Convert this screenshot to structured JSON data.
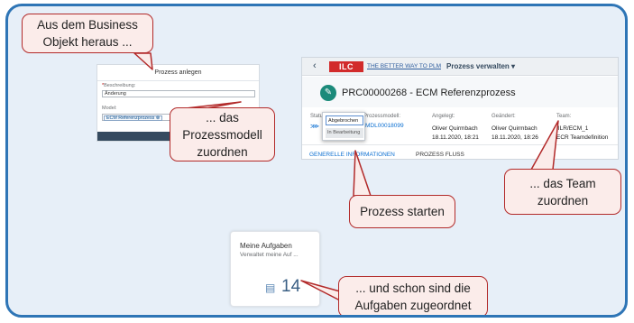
{
  "callouts": {
    "business_object": "Aus dem Business Objekt heraus ...",
    "process_model": "... das Prozessmodell zuordnen",
    "start_process": "Prozess starten",
    "team": "... das Team zuordnen",
    "tasks": "... und schon sind die Aufgaben zugeordnet"
  },
  "dialog": {
    "title": "Prozess anlegen",
    "description_label": "Beschreibung:",
    "description_value": "Änderung",
    "model_label": "Model:",
    "model_token": "ECM Referenzprozess ⊗",
    "value_help_icon": "value-help-icon"
  },
  "app": {
    "back_icon": "back-icon",
    "logo_text": "ILC",
    "tagline": "THE BETTER WAY TO PLM",
    "app_title": "Prozess verwalten ▾",
    "avatar_icon": "wrench-icon",
    "object_title": "PRC00000268 - ECM Referenzprozess",
    "status_label": "Status",
    "status_menu": [
      "Abgebrochen",
      "In Bearbeitung"
    ],
    "model_label": "Prozessmodell:",
    "model_value": "MDL00018099",
    "created_label": "Angelegt:",
    "created_by": "Oliver Quirmbach",
    "created_at": "18.11.2020, 18:21",
    "changed_label": "Geändert:",
    "changed_by": "Oliver Quirmbach",
    "changed_at": "18.11.2020, 18:26",
    "team_label": "Team:",
    "team_id": "/ILR/ECM_1",
    "team_name": "ECR Teamdefinition",
    "tabs": [
      "GENERELLE INFORMATIONEN",
      "PROZESS FLUSS"
    ]
  },
  "tile": {
    "title": "Meine Aufgaben",
    "subtitle": "Verwaltet meine Auf ...",
    "icon": "task-icon",
    "count": "14"
  },
  "colors": {
    "slide_border": "#2e75b6",
    "slide_bg": "#e7eff8",
    "callout_border": "#b22a2a",
    "callout_fill": "#fbecea",
    "brand_red": "#d22b2b"
  }
}
